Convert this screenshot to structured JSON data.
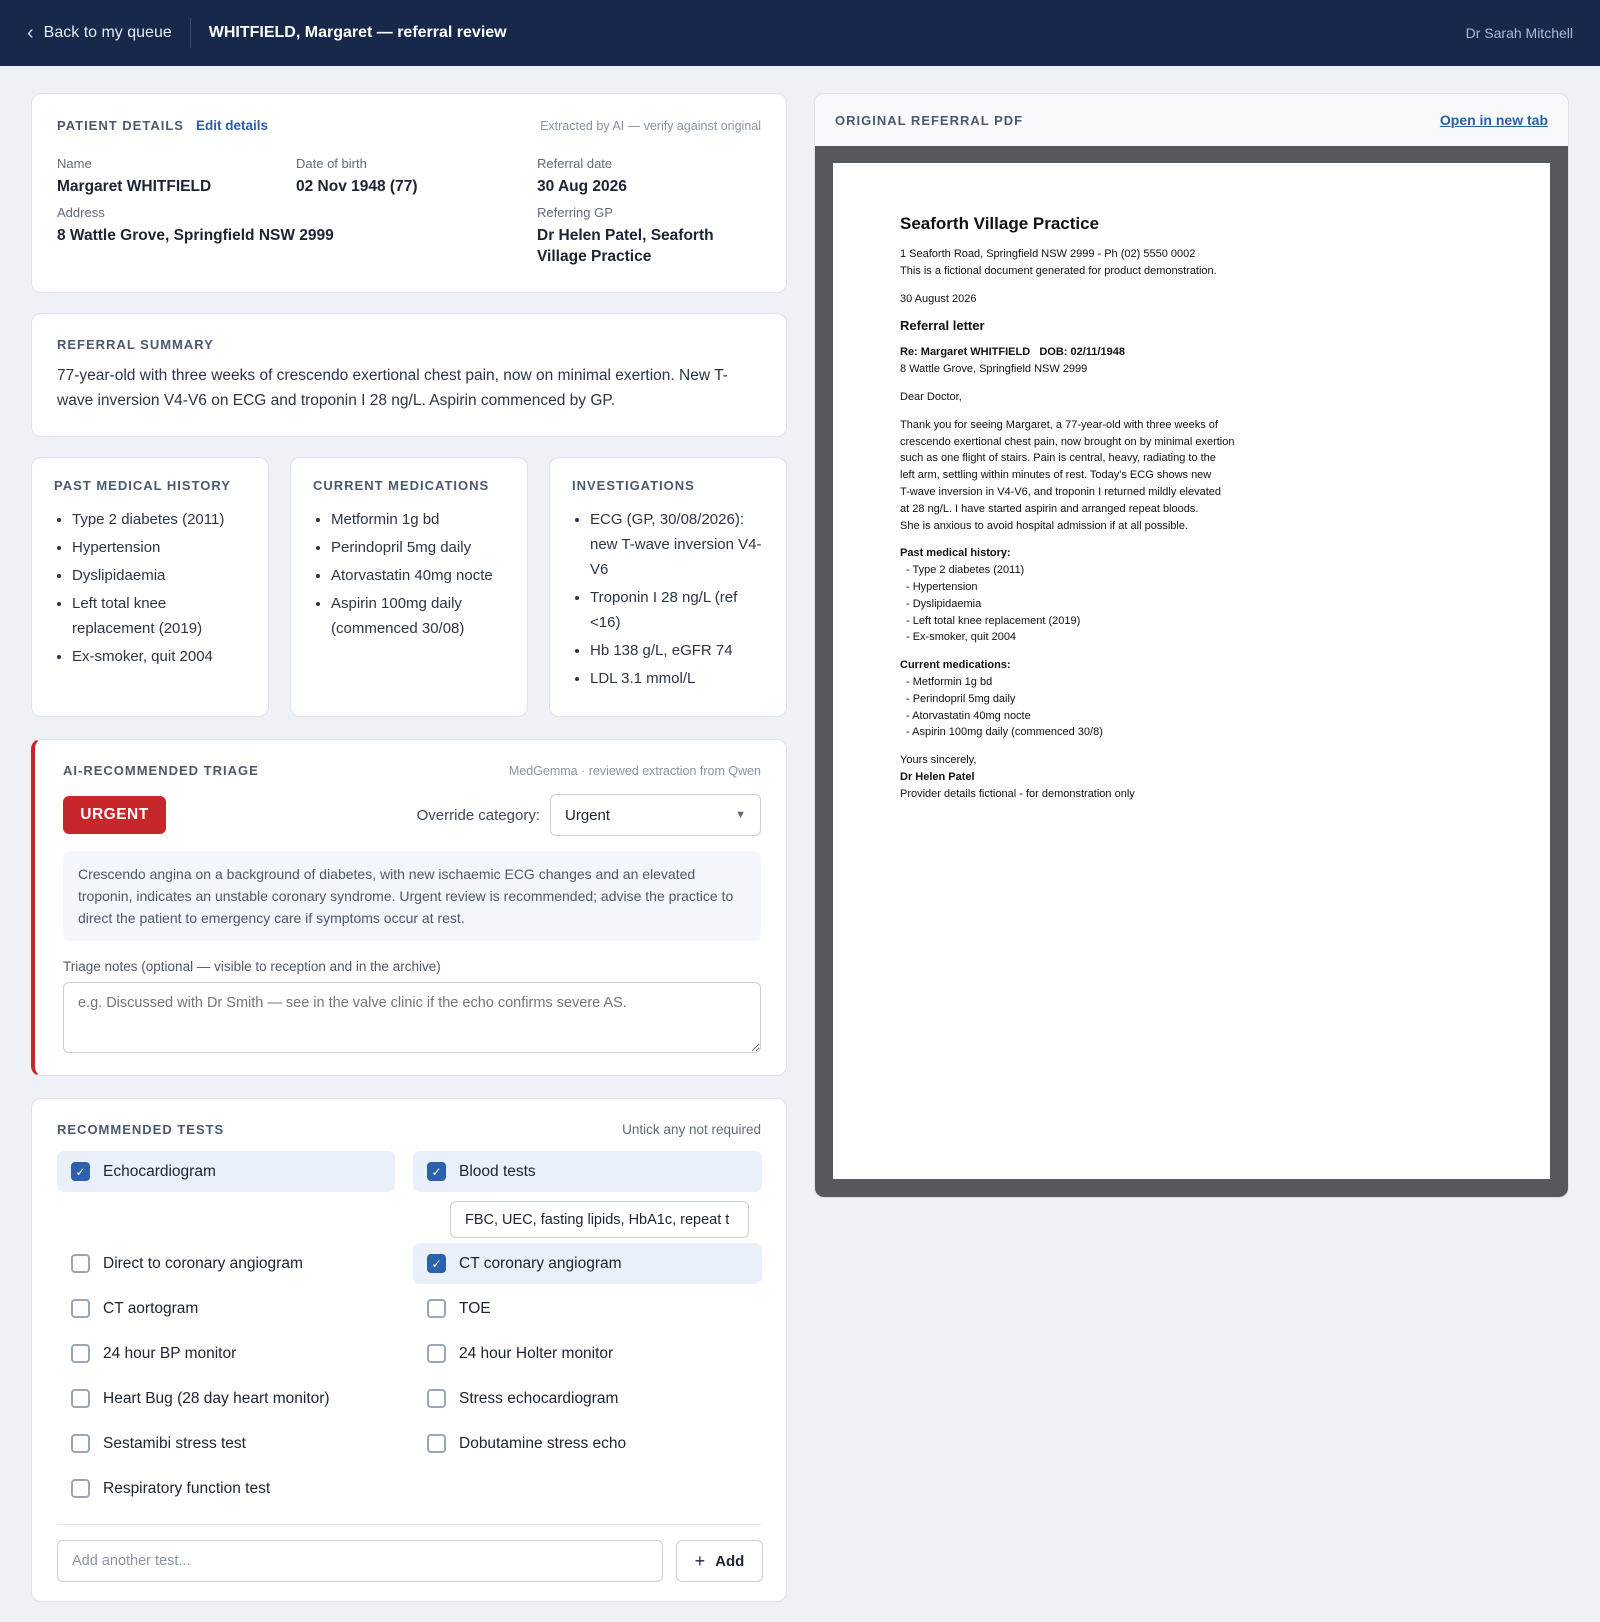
{
  "header": {
    "back_label": "Back to my queue",
    "title": "WHITFIELD, Margaret — referral review",
    "user": "Dr Sarah Mitchell"
  },
  "patient": {
    "section_label": "PATIENT DETAILS",
    "edit_label": "Edit details",
    "ai_note": "Extracted by AI — verify against original",
    "name_label": "Name",
    "name": "Margaret WHITFIELD",
    "dob_label": "Date of birth",
    "dob": "02 Nov 1948 (77)",
    "referral_date_label": "Referral date",
    "referral_date": "30 Aug 2026",
    "address_label": "Address",
    "address": "8 Wattle Grove, Springfield NSW 2999",
    "gp_label": "Referring GP",
    "gp": "Dr Helen Patel, Seaforth Village Practice"
  },
  "summary": {
    "label": "REFERRAL SUMMARY",
    "text": "77-year-old with three weeks of crescendo exertional chest pain, now on minimal exertion. New T-wave inversion V4-V6 on ECG and troponin I 28 ng/L. Aspirin commenced by GP."
  },
  "pmh": {
    "label": "PAST MEDICAL HISTORY",
    "items": [
      "Type 2 diabetes (2011)",
      "Hypertension",
      "Dyslipidaemia",
      "Left total knee replacement (2019)",
      "Ex-smoker, quit 2004"
    ]
  },
  "meds": {
    "label": "CURRENT MEDICATIONS",
    "items": [
      "Metformin 1g bd",
      "Perindopril 5mg daily",
      "Atorvastatin 40mg nocte",
      "Aspirin 100mg daily (commenced 30/08)"
    ]
  },
  "inv": {
    "label": "INVESTIGATIONS",
    "items": [
      "ECG (GP, 30/08/2026): new T-wave inversion V4-V6",
      "Troponin I 28 ng/L (ref <16)",
      "Hb 138 g/L, eGFR 74",
      "LDL 3.1 mmol/L"
    ]
  },
  "triage": {
    "label": "AI-RECOMMENDED TRIAGE",
    "model_note": "MedGemma · reviewed extraction from Qwen",
    "category": "URGENT",
    "category_color": "#c7262b",
    "override_label": "Override category:",
    "override_value": "Urgent",
    "reasoning": "Crescendo angina on a background of diabetes, with new ischaemic ECG changes and an elevated troponin, indicates an unstable coronary syndrome. Urgent review is recommended; advise the practice to direct the patient to emergency care if symptoms occur at rest.",
    "notes_label": "Triage notes (optional — visible to reception and in the archive)",
    "notes_placeholder": "e.g. Discussed with Dr Smith — see in the valve clinic if the echo confirms severe AS."
  },
  "tests": {
    "label": "RECOMMENDED TESTS",
    "hint": "Untick any not required",
    "items": [
      {
        "label": "Echocardiogram",
        "checked": true
      },
      {
        "label": "Blood tests",
        "checked": true
      },
      {
        "label": "Direct to coronary angiogram",
        "checked": false
      },
      {
        "label": "CT coronary angiogram",
        "checked": true
      },
      {
        "label": "CT aortogram",
        "checked": false
      },
      {
        "label": "TOE",
        "checked": false
      },
      {
        "label": "24 hour BP monitor",
        "checked": false
      },
      {
        "label": "24 hour Holter monitor",
        "checked": false
      },
      {
        "label": "Heart Bug (28 day heart monitor)",
        "checked": false
      },
      {
        "label": "Stress echocardiogram",
        "checked": false
      },
      {
        "label": "Sestamibi stress test",
        "checked": false
      },
      {
        "label": "Dobutamine stress echo",
        "checked": false
      },
      {
        "label": "Respiratory function test",
        "checked": false
      }
    ],
    "blood_detail": "FBC, UEC, fasting lipids, HbA1c, repeat t",
    "add_placeholder": "Add another test...",
    "add_label": "Add"
  },
  "pdf": {
    "label": "ORIGINAL REFERRAL PDF",
    "open_label": "Open in new tab",
    "practice": "Seaforth Village Practice",
    "practice_addr": "1 Seaforth Road, Springfield NSW 2999 - Ph (02) 5550 0002",
    "fictional": "This is a fictional document generated for product demonstration.",
    "date": "30 August 2026",
    "heading": "Referral letter",
    "re": "Re: Margaret WHITFIELD   DOB: 02/11/1948",
    "address": "8 Wattle Grove, Springfield NSW 2999",
    "salutation": "Dear Doctor,",
    "body": [
      "Thank you for seeing Margaret, a 77-year-old with three weeks of",
      "crescendo exertional chest pain, now brought on by minimal exertion",
      "such as one flight of stairs. Pain is central, heavy, radiating to the",
      "left arm, settling within minutes of rest. Today's ECG shows new",
      "T-wave inversion in V4-V6, and troponin I returned mildly elevated",
      "at 28 ng/L. I have started aspirin and arranged repeat bloods.",
      "She is anxious to avoid hospital admission if at all possible."
    ],
    "pmh_heading": "Past medical history:",
    "pmh": [
      "- Type 2 diabetes (2011)",
      "- Hypertension",
      "- Dyslipidaemia",
      "- Left total knee replacement (2019)",
      "- Ex-smoker, quit 2004"
    ],
    "meds_heading": "Current medications:",
    "meds": [
      "- Metformin 1g bd",
      "- Perindopril 5mg daily",
      "- Atorvastatin 40mg nocte",
      "- Aspirin 100mg daily (commenced 30/8)"
    ],
    "closing": "Yours sincerely,",
    "signatory": "Dr Helen Patel",
    "footer": "Provider details fictional - for demonstration only"
  }
}
